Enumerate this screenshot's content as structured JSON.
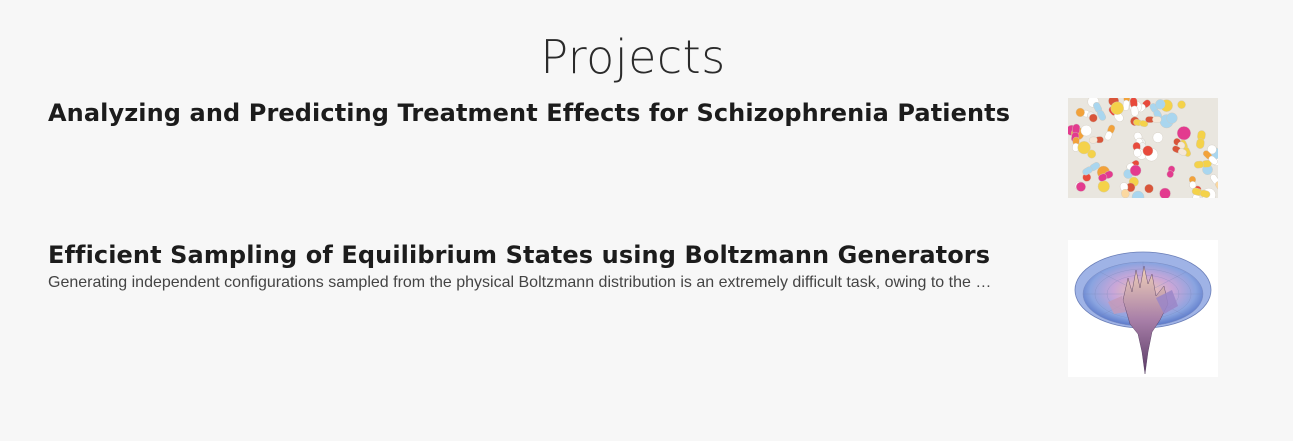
{
  "page": {
    "section_title": "Projects"
  },
  "projects": [
    {
      "title": "Analyzing and Predicting Treatment Effects for Schizophrenia Patients",
      "summary": "",
      "thumbnail_icon": "pills-image"
    },
    {
      "title": "Efficient Sampling of Equilibrium States using Boltzmann Generators",
      "summary": "Generating independent configurations sampled from the physical Boltzmann distribution is an extremely difficult task, owing to the …",
      "thumbnail_icon": "energy-surface-image"
    }
  ],
  "colors": {
    "background": "#f7f7f7",
    "title_text": "#1c1c1c",
    "summary_text": "#444444"
  }
}
